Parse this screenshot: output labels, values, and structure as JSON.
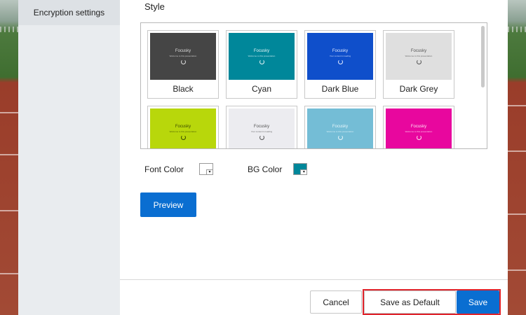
{
  "sidebar": {
    "active_item": "Encryption settings"
  },
  "style_section": {
    "label": "Style",
    "themes": [
      {
        "name": "Black",
        "bg": "#454545",
        "fg": "#dddddd",
        "preview_title": "Focusky",
        "preview_sub": "Welcome to this presentation"
      },
      {
        "name": "Cyan",
        "bg": "#00879a",
        "fg": "#e6f6f8",
        "preview_title": "Focusky",
        "preview_sub": "Welcome to this presentation"
      },
      {
        "name": "Dark Blue",
        "bg": "#0f4fcb",
        "fg": "#e3ebff",
        "preview_title": "Focusky",
        "preview_sub": "Your content is loading"
      },
      {
        "name": "Dark Grey",
        "bg": "#dfdfdf",
        "fg": "#555555",
        "preview_title": "Focusky",
        "preview_sub": "Welcome to this presentation"
      },
      {
        "name": "",
        "bg": "#b8d70b",
        "fg": "#3a4a00",
        "preview_title": "Focusky",
        "preview_sub": "Welcome to this presentation"
      },
      {
        "name": "",
        "bg": "#ececf0",
        "fg": "#555555",
        "preview_title": "Focusky",
        "preview_sub": "Your content is loading"
      },
      {
        "name": "",
        "bg": "#74bdd6",
        "fg": "#e8f6fb",
        "preview_title": "Focusky",
        "preview_sub": "Welcome to this presentation"
      },
      {
        "name": "",
        "bg": "#e8079e",
        "fg": "#ffe1f4",
        "preview_title": "Focusky",
        "preview_sub": "Welcome to this presentation"
      }
    ]
  },
  "colors": {
    "font_color_label": "Font Color",
    "font_color_value": "#ffffff",
    "bg_color_label": "BG Color",
    "bg_color_value": "#00879a",
    "dropdown_arrow": "▾"
  },
  "buttons": {
    "preview": "Preview",
    "cancel": "Cancel",
    "save_default": "Save as Default",
    "save": "Save"
  },
  "accent": {
    "primary": "#0a6ed1",
    "highlight": "#e0232b"
  }
}
